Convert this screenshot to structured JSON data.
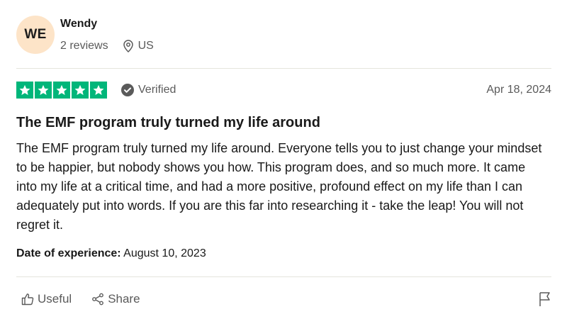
{
  "reviewer": {
    "initials": "WE",
    "name": "Wendy",
    "reviews_count": "2 reviews",
    "location": "US"
  },
  "rating": {
    "stars": 5,
    "max_stars": 5,
    "star_color": "#00b67a",
    "verified_label": "Verified",
    "date": "Apr 18, 2024"
  },
  "review": {
    "title": "The EMF program truly turned my life around",
    "body": "The EMF program truly turned my life around. Everyone tells you to just change your mindset to be happier, but nobody shows you how. This program does, and so much more. It came into my life at a critical time, and had a more positive, profound effect on my life than I can adequately put into words. If you are this far into researching it - take the leap! You will not regret it.",
    "experience_label": "Date of experience:",
    "experience_date": "August 10, 2023"
  },
  "actions": {
    "useful_label": "Useful",
    "share_label": "Share"
  },
  "icons": {
    "location": "location-pin-icon",
    "verified": "check-circle-icon",
    "useful": "thumbs-up-icon",
    "share": "share-icon",
    "report": "flag-icon"
  }
}
